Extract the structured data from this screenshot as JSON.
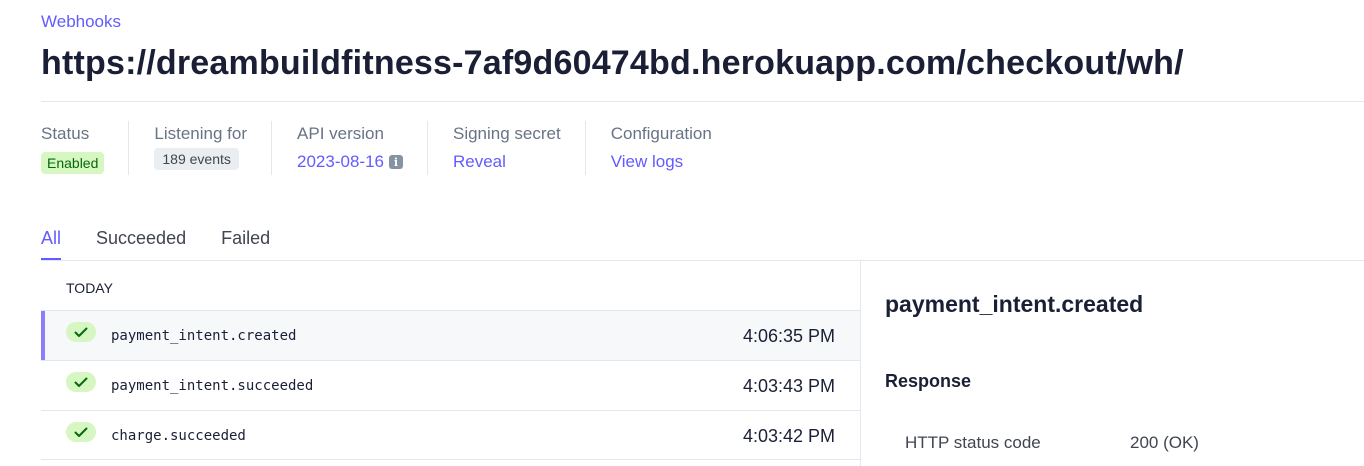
{
  "breadcrumb": "Webhooks",
  "title": "https://dreambuildfitness-7af9d60474bd.herokuapp.com/checkout/wh/",
  "meta": {
    "status": {
      "label": "Status",
      "value": "Enabled"
    },
    "listening": {
      "label": "Listening for",
      "value": "189 events"
    },
    "api": {
      "label": "API version",
      "value": "2023-08-16",
      "icon": "info-icon"
    },
    "secret": {
      "label": "Signing secret",
      "value": "Reveal"
    },
    "config": {
      "label": "Configuration",
      "value": "View logs"
    }
  },
  "tabs": [
    {
      "label": "All",
      "active": true
    },
    {
      "label": "Succeeded",
      "active": false
    },
    {
      "label": "Failed",
      "active": false
    }
  ],
  "list": {
    "group_label": "TODAY",
    "events": [
      {
        "name": "payment_intent.created",
        "time": "4:06:35 PM",
        "status_icon": "check-icon",
        "selected": true
      },
      {
        "name": "payment_intent.succeeded",
        "time": "4:03:43 PM",
        "status_icon": "check-icon",
        "selected": false
      },
      {
        "name": "charge.succeeded",
        "time": "4:03:42 PM",
        "status_icon": "check-icon",
        "selected": false
      }
    ]
  },
  "detail": {
    "title": "payment_intent.created",
    "section": "Response",
    "http_key": "HTTP status code",
    "http_value": "200 (OK)"
  },
  "colors": {
    "accent": "#635bff",
    "success_bg": "#d7f7c2",
    "success_fg": "#05690d",
    "selected_bar": "#8d7ffa"
  }
}
